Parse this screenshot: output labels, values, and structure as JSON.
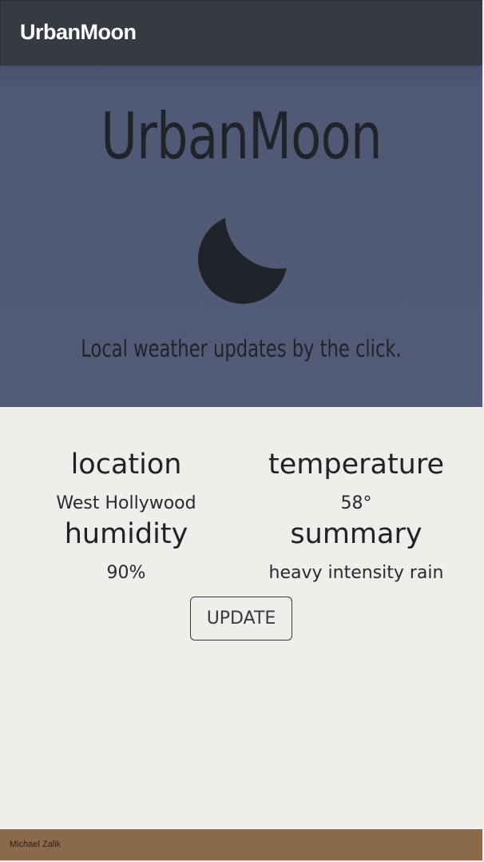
{
  "navbar": {
    "brand": "UrbanMoon"
  },
  "hero": {
    "title": "UrbanMoon",
    "icon": "crescent-moon-icon",
    "tagline": "Local weather updates by the click."
  },
  "weather": {
    "location_label": "location",
    "location_value": "West Hollywood",
    "temperature_label": "temperature",
    "temperature_value": "58°",
    "humidity_label": "humidity",
    "humidity_value": "90%",
    "summary_label": "summary",
    "summary_value": "heavy intensity rain"
  },
  "actions": {
    "update_label": "UPDATE"
  },
  "footer": {
    "author": "Michael Zalik"
  },
  "colors": {
    "navbar_bg": "#353a43",
    "hero_bg": "#525c77",
    "content_bg": "#eeeeea",
    "footer_bg": "#8a6a4b",
    "text_dark": "#20242a"
  }
}
